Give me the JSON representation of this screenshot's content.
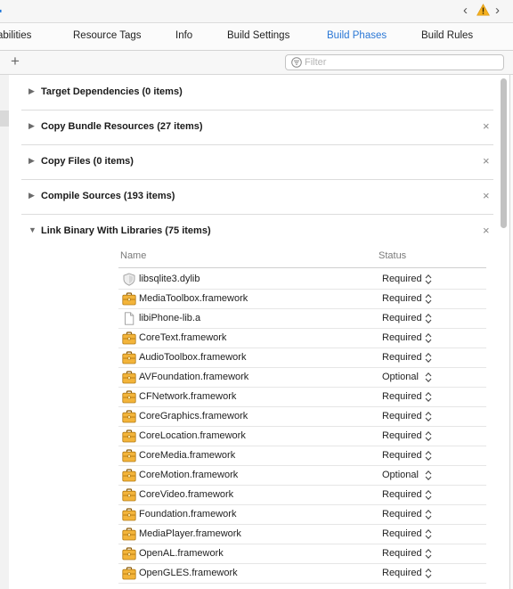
{
  "topbar": {
    "nav_back_glyph": "‹",
    "nav_forward_glyph": "›",
    "warning_icon": "warning-triangle-icon",
    "accent": "#2b78d6",
    "warning_color": "#f5b01e"
  },
  "tabs": [
    {
      "label": "abilities",
      "active": false
    },
    {
      "label": "Resource Tags",
      "active": false
    },
    {
      "label": "Info",
      "active": false
    },
    {
      "label": "Build Settings",
      "active": false
    },
    {
      "label": "Build Phases",
      "active": true
    },
    {
      "label": "Build Rules",
      "active": false
    }
  ],
  "filter": {
    "add_glyph": "+",
    "placeholder": "Filter",
    "value": ""
  },
  "phases": [
    {
      "title": "Target Dependencies (0 items)",
      "expanded": false,
      "deletable": false
    },
    {
      "title": "Copy Bundle Resources (27 items)",
      "expanded": false,
      "deletable": true
    },
    {
      "title": "Copy Files (0 items)",
      "expanded": false,
      "deletable": true
    },
    {
      "title": "Compile Sources (193 items)",
      "expanded": false,
      "deletable": true
    },
    {
      "title": "Link Binary With Libraries (75 items)",
      "expanded": true,
      "deletable": true
    }
  ],
  "phase_glyphs": {
    "collapsed": "▶",
    "expanded": "▼",
    "delete": "×"
  },
  "libraries": {
    "columns": {
      "name": "Name",
      "status": "Status"
    },
    "rows": [
      {
        "name": "libsqlite3.dylib",
        "status": "Required",
        "icon": "dylib-shield-icon"
      },
      {
        "name": "MediaToolbox.framework",
        "status": "Required",
        "icon": "framework-toolbox-icon"
      },
      {
        "name": "libiPhone-lib.a",
        "status": "Required",
        "icon": "static-library-file-icon"
      },
      {
        "name": "CoreText.framework",
        "status": "Required",
        "icon": "framework-toolbox-icon"
      },
      {
        "name": "AudioToolbox.framework",
        "status": "Required",
        "icon": "framework-toolbox-icon"
      },
      {
        "name": "AVFoundation.framework",
        "status": "Optional",
        "icon": "framework-toolbox-icon"
      },
      {
        "name": "CFNetwork.framework",
        "status": "Required",
        "icon": "framework-toolbox-icon"
      },
      {
        "name": "CoreGraphics.framework",
        "status": "Required",
        "icon": "framework-toolbox-icon"
      },
      {
        "name": "CoreLocation.framework",
        "status": "Required",
        "icon": "framework-toolbox-icon"
      },
      {
        "name": "CoreMedia.framework",
        "status": "Required",
        "icon": "framework-toolbox-icon"
      },
      {
        "name": "CoreMotion.framework",
        "status": "Optional",
        "icon": "framework-toolbox-icon"
      },
      {
        "name": "CoreVideo.framework",
        "status": "Required",
        "icon": "framework-toolbox-icon"
      },
      {
        "name": "Foundation.framework",
        "status": "Required",
        "icon": "framework-toolbox-icon"
      },
      {
        "name": "MediaPlayer.framework",
        "status": "Required",
        "icon": "framework-toolbox-icon"
      },
      {
        "name": "OpenAL.framework",
        "status": "Required",
        "icon": "framework-toolbox-icon"
      },
      {
        "name": "OpenGLES.framework",
        "status": "Required",
        "icon": "framework-toolbox-icon"
      }
    ]
  }
}
